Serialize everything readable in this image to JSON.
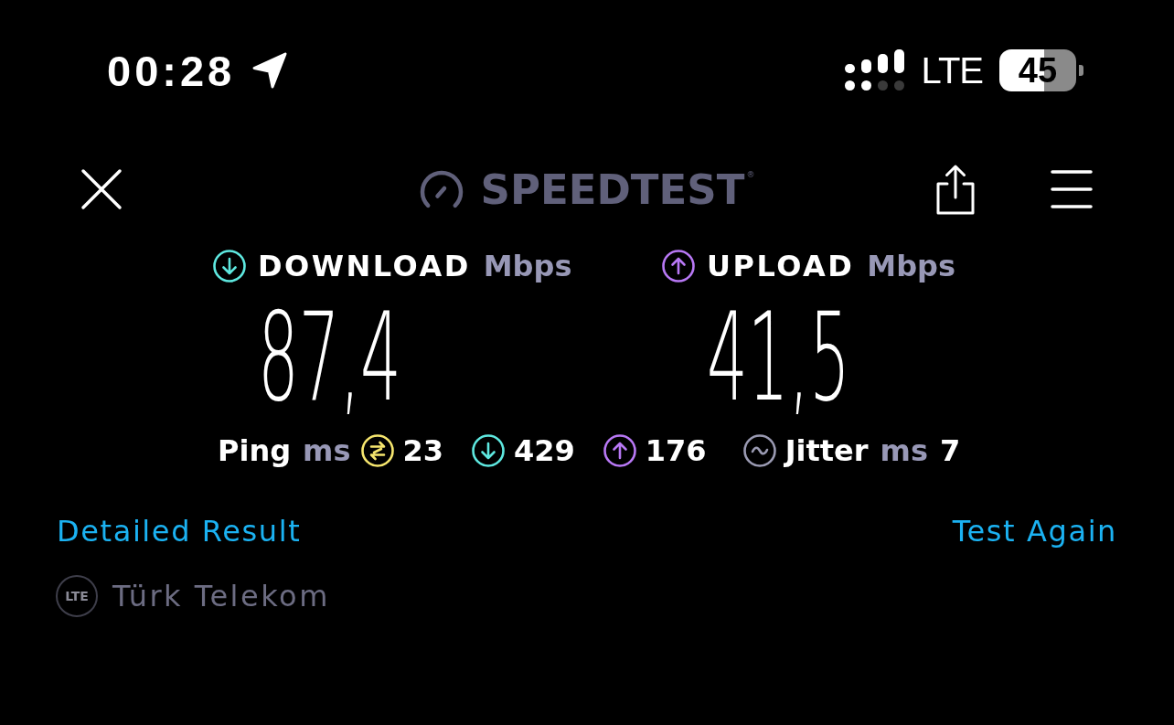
{
  "status_bar": {
    "time": "00:28",
    "network": "LTE",
    "battery": "45"
  },
  "header": {
    "logo": "SPEEDTEST$^{®}$"
  },
  "results": [
    {
      "kind": "download",
      "label": "DOWNLOAD",
      "unit": "Mbps",
      "value": "87,4",
      "color": "#5ee8e0"
    },
    {
      "kind": "upload",
      "label": "UPLOAD",
      "unit": "Mbps",
      "value": "41,5",
      "color": "#b878f5"
    }
  ],
  "ping": {
    "label": "Ping",
    "unit": "ms",
    "readings": [
      {
        "kind": "idle",
        "value": "23",
        "color": "#f6e66e"
      },
      {
        "kind": "download",
        "value": "429",
        "color": "#5ee8e0"
      },
      {
        "kind": "upload",
        "value": "176",
        "color": "#b878f5"
      }
    ]
  },
  "jitter": {
    "label": "Jitter",
    "unit": "ms",
    "value": "7"
  },
  "links": [
    "Detailed Result",
    "Test Again"
  ],
  "provider": {
    "network": "LTE",
    "name": "Türk Telekom"
  }
}
